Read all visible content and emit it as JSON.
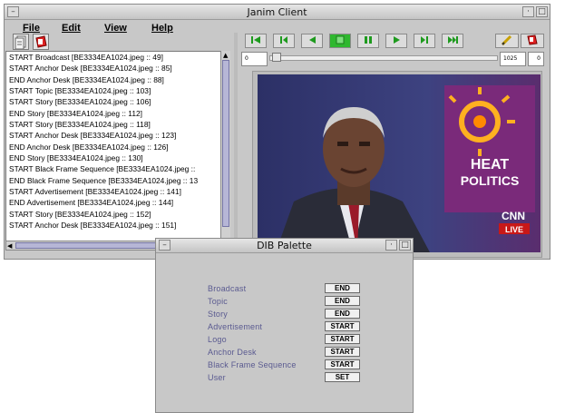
{
  "main_window": {
    "title": "Janim Client",
    "menu": [
      "File",
      "Edit",
      "View",
      "Help"
    ]
  },
  "log": {
    "rows": [
      "START Broadcast [BE3334EA1024.jpeg :: 49]",
      "START Anchor Desk [BE3334EA1024.jpeg :: 85]",
      "END Anchor Desk [BE3334EA1024.jpeg :: 88]",
      "START Topic [BE3334EA1024.jpeg :: 103]",
      "START Story [BE3334EA1024.jpeg :: 106]",
      "END Story [BE3334EA1024.jpeg :: 112]",
      "START Story [BE3334EA1024.jpeg :: 118]",
      "START Anchor Desk [BE3334EA1024.jpeg :: 123]",
      "END Anchor Desk [BE3334EA1024.jpeg :: 126]",
      "END Story [BE3334EA1024.jpeg :: 130]",
      "START Black Frame Sequence [BE3334EA1024.jpeg ::",
      "END Black Frame Sequence [BE3334EA1024.jpeg :: 13",
      "START Advertisement [BE3334EA1024.jpeg :: 141]",
      "END Advertisement [BE3334EA1024.jpeg :: 144]",
      "START Story [BE3334EA1024.jpeg :: 152]",
      "START Anchor Desk [BE3334EA1024.jpeg :: 151]"
    ]
  },
  "player": {
    "slider_start": "0",
    "slider_end": "1025",
    "frame_value": "0",
    "colors": {
      "control_green": "#1e9a1e",
      "active_button": "#2fb82f"
    },
    "video": {
      "graphic_line1": "HEAT",
      "graphic_line2": "POLITICS",
      "logo": "CNN",
      "badge": "LIVE"
    }
  },
  "palette": {
    "title": "DIB Palette",
    "rows": [
      {
        "label": "Broadcast",
        "state": "END"
      },
      {
        "label": "Topic",
        "state": "END"
      },
      {
        "label": "Story",
        "state": "END"
      },
      {
        "label": "Advertisement",
        "state": "START"
      },
      {
        "label": "Logo",
        "state": "START"
      },
      {
        "label": "Anchor Desk",
        "state": "START"
      },
      {
        "label": "Black Frame Sequence",
        "state": "START"
      },
      {
        "label": "User",
        "state": "SET"
      }
    ]
  }
}
